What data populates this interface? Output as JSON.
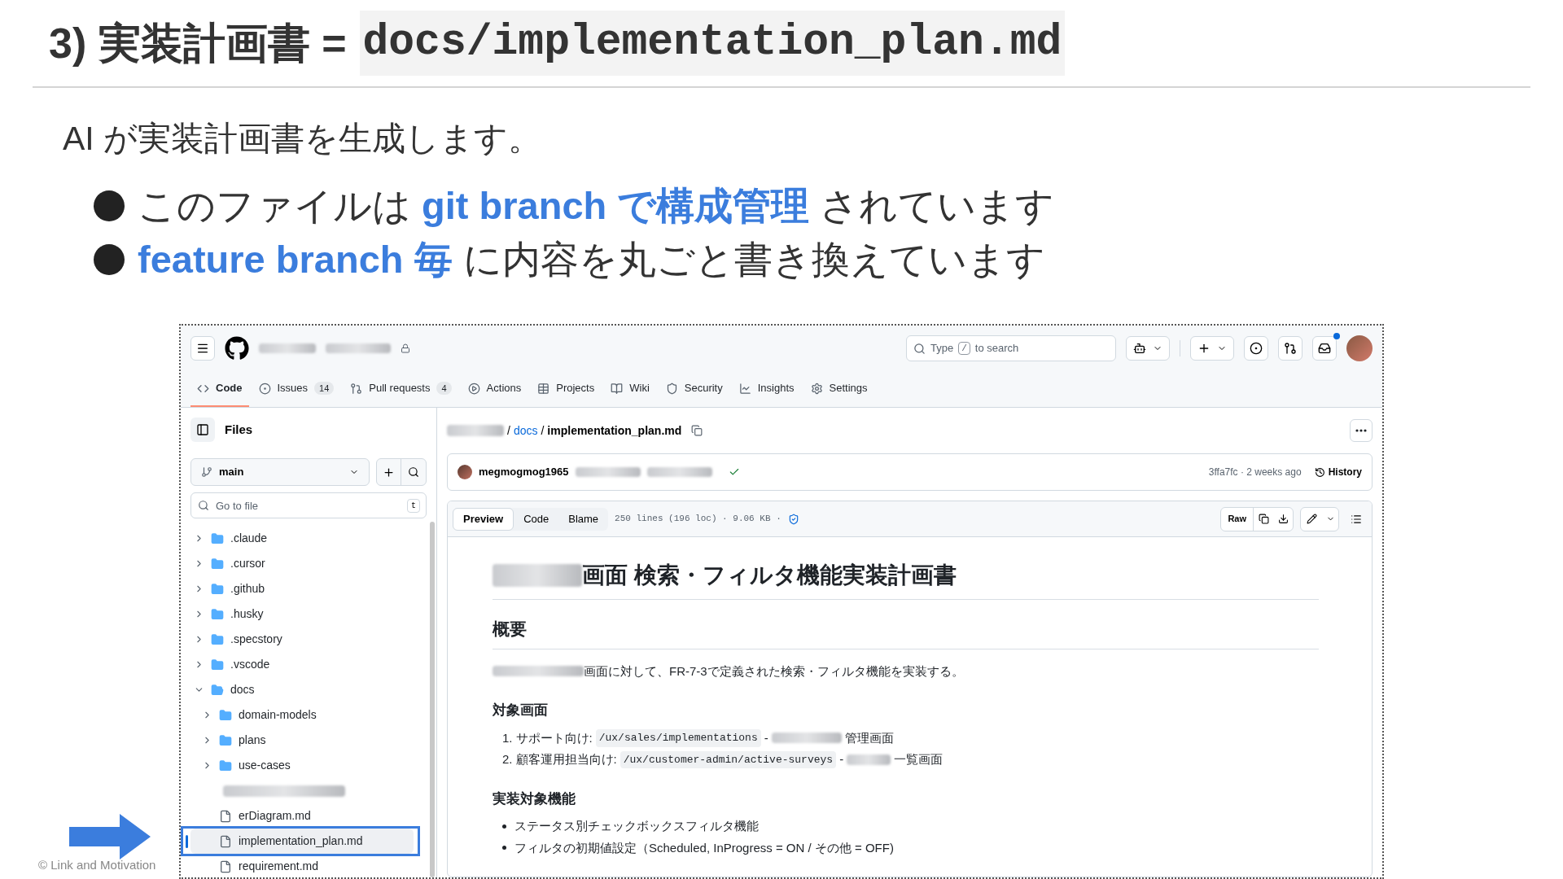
{
  "slide": {
    "title": "3) 実装計画書 =",
    "title_code": "docs/implementation_plan.md",
    "lead": "AI が実装計画書を生成します。",
    "bullets": [
      "このファイルは **git branch で構成管理** されています",
      "**feature branch 毎** に内容を丸ごと書き換えています"
    ],
    "footer": "© Link and Motivation"
  },
  "github": {
    "search": {
      "before": "Type",
      "key": "/",
      "after": "to search"
    },
    "tabs": [
      {
        "label": "Code",
        "selected": true
      },
      {
        "label": "Issues",
        "count": "14",
        "selected": false
      },
      {
        "label": "Pull requests",
        "count": "4",
        "selected": false
      },
      {
        "label": "Actions",
        "selected": false
      },
      {
        "label": "Projects",
        "selected": false
      },
      {
        "label": "Wiki",
        "selected": false
      },
      {
        "label": "Security",
        "selected": false
      },
      {
        "label": "Insights",
        "selected": false
      },
      {
        "label": "Settings",
        "selected": false
      }
    ],
    "sidebar": {
      "title": "Files",
      "branch": "main",
      "filter_placeholder": "Go to file",
      "filter_key": "t",
      "tree": [
        {
          "kind": "folder",
          "name": ".claude",
          "expanded": false
        },
        {
          "kind": "folder",
          "name": ".cursor",
          "expanded": false
        },
        {
          "kind": "folder",
          "name": ".github",
          "expanded": false
        },
        {
          "kind": "folder",
          "name": ".husky",
          "expanded": false
        },
        {
          "kind": "folder",
          "name": ".specstory",
          "expanded": false
        },
        {
          "kind": "folder",
          "name": ".vscode",
          "expanded": false
        },
        {
          "kind": "folder",
          "name": "docs",
          "expanded": true,
          "children": [
            {
              "kind": "folder",
              "name": "domain-models",
              "expanded": false
            },
            {
              "kind": "folder",
              "name": "plans",
              "expanded": false
            },
            {
              "kind": "folder",
              "name": "use-cases",
              "expanded": false
            },
            {
              "kind": "redacted"
            },
            {
              "kind": "file",
              "name": "erDiagram.md",
              "selected": false
            },
            {
              "kind": "file",
              "name": "implementation_plan.md",
              "selected": true,
              "callout": true
            },
            {
              "kind": "file",
              "name": "requirement.md",
              "selected": false
            }
          ]
        }
      ]
    },
    "file": {
      "dir_separator": "/",
      "dir": "docs",
      "file_separator": "/",
      "name": "implementation_plan.md",
      "commit": {
        "author": "megmogmog1965",
        "meta": "3ffa7fc · 2 weeks ago",
        "history": "History"
      },
      "views": [
        {
          "label": "Preview",
          "selected": true
        },
        {
          "label": "Code",
          "selected": false
        },
        {
          "label": "Blame",
          "selected": false
        }
      ],
      "info": "250 lines (196 loc) · 9.06 KB ·",
      "raw": "Raw",
      "markdown": [
        {
          "kind": "h1",
          "text": "画面 検索・フィルタ機能実装計画書"
        },
        {
          "kind": "h2",
          "text": "概要"
        },
        {
          "kind": "p",
          "text": "画面に対して、FR-7-3で定義された検索・フィルタ機能を実装する。"
        },
        {
          "kind": "h3",
          "text": "対象画面"
        },
        {
          "kind": "ol",
          "items": [
            {
              "number": "1.",
              "label": "サポート向け:",
              "code": "/ux/sales/implementations",
              "dash": "-",
              "suffix": "管理画面"
            },
            {
              "number": "2.",
              "label": "顧客運用担当向け:",
              "code": "/ux/customer-admin/active-surveys",
              "dash": "-",
              "suffix": "一覧画面"
            }
          ]
        },
        {
          "kind": "h3",
          "text": "実装対象機能"
        },
        {
          "kind": "ul",
          "items": [
            "ステータス別チェックボックスフィルタ機能",
            "フィルタの初期値設定（Scheduled, InProgress = ON / その他 = OFF)"
          ]
        }
      ]
    }
  }
}
